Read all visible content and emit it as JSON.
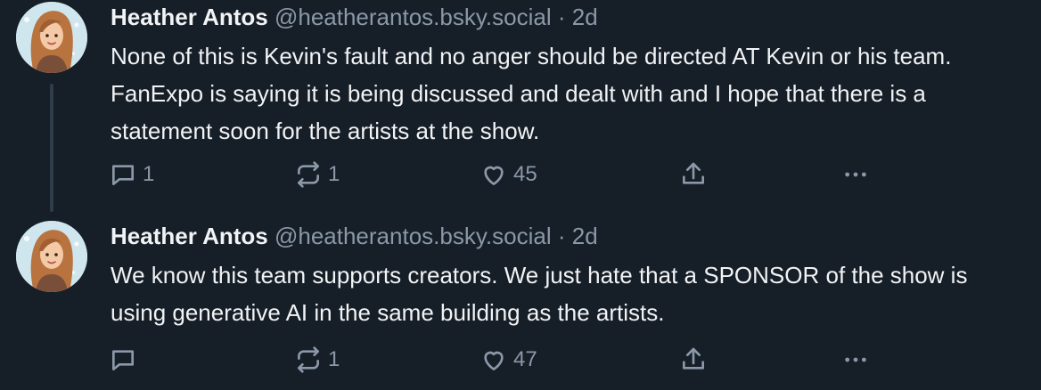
{
  "posts": [
    {
      "author_name": "Heather Antos",
      "handle": "@heatherantos.bsky.social",
      "separator": "·",
      "time": "2d",
      "text": "None of this is Kevin's fault and no anger should be directed AT Kevin or his team. FanExpo is saying it is being discussed and dealt with and I hope that there is a statement soon for the artists at the show.",
      "reply_count": "1",
      "repost_count": "1",
      "like_count": "45"
    },
    {
      "author_name": "Heather Antos",
      "handle": "@heatherantos.bsky.social",
      "separator": "·",
      "time": "2d",
      "text": "We know this team supports creators. We just hate that a SPONSOR of the show is using generative AI in the same building as the artists.",
      "reply_count": "",
      "repost_count": "1",
      "like_count": "47"
    }
  ],
  "icons": {
    "reply": "reply-icon",
    "repost": "repost-icon",
    "like": "heart-icon",
    "share": "share-icon",
    "more": "more-icon"
  },
  "colors": {
    "background": "#161e27",
    "text": "#f1f3f5",
    "muted": "#8a98a8",
    "thread_line": "#2e3c4c"
  }
}
